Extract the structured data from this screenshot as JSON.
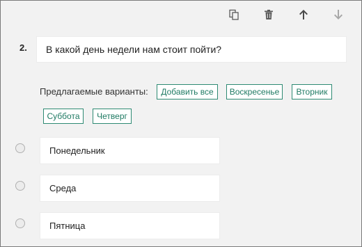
{
  "toolbar": {
    "icons": [
      "copy-icon",
      "delete-icon",
      "arrow-up-icon",
      "arrow-down-icon"
    ],
    "icon_color": "#5a5a5a",
    "disabled_color": "#a8a8a8"
  },
  "question": {
    "number": "2.",
    "text": "В какой день недели нам стоит пойти?"
  },
  "suggestions": {
    "label": "Предлагаемые варианты:",
    "add_all": "Добавить все",
    "items": [
      "Воскресенье",
      "Вторник",
      "Суббота",
      "Четверг"
    ]
  },
  "options": [
    "Понедельник",
    "Среда",
    "Пятница"
  ],
  "colors": {
    "accent": "#2e8a73",
    "background": "#f2f2f2"
  }
}
